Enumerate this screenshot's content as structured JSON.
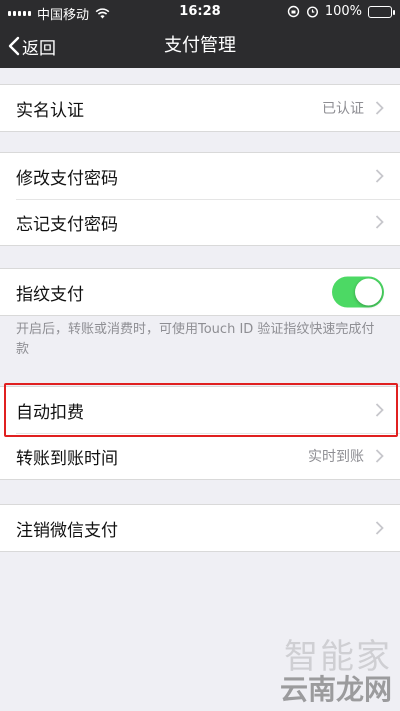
{
  "status_bar": {
    "carrier": "中国移动",
    "time": "16:28",
    "battery": "100%",
    "battery_level": 1.0
  },
  "nav": {
    "back_label": "返回",
    "title": "支付管理"
  },
  "sections": {
    "realname": {
      "label": "实名认证",
      "value": "已认证"
    },
    "change_password": {
      "label": "修改支付密码"
    },
    "forgot_password": {
      "label": "忘记支付密码"
    },
    "fingerprint": {
      "label": "指纹支付",
      "enabled": true,
      "note": "开启后，转账或消费时，可使用Touch ID 验证指纹快速完成付款"
    },
    "auto_deduct": {
      "label": "自动扣费"
    },
    "transfer_time": {
      "label": "转账到账时间",
      "value": "实时到账"
    },
    "cancel_wechat_pay": {
      "label": "注销微信支付"
    }
  },
  "watermark": {
    "top": "智能家",
    "bottom": "云南龙网"
  },
  "colors": {
    "toggle_on": "#4cd964",
    "highlight": "#e02020",
    "nav_bg": "#2c2c2e",
    "page_bg": "#efeff4"
  }
}
